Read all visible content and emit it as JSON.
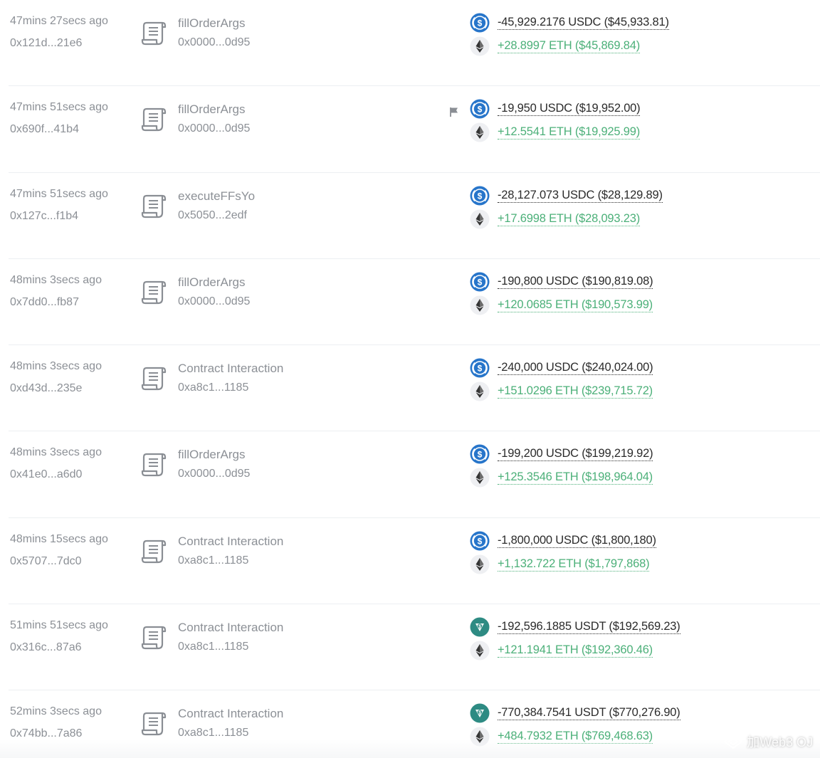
{
  "transactions": [
    {
      "time": "47mins 27secs ago",
      "hash": "0x121d...21e6",
      "method": "fillOrderArgs",
      "contract": "0x0000...0d95",
      "flagged": false,
      "out": {
        "token": "usdc-icon",
        "text": "-45,929.2176 USDC ($45,933.81)"
      },
      "in": {
        "token": "eth-icon",
        "text": "+28.8997 ETH ($45,869.84)"
      }
    },
    {
      "time": "47mins 51secs ago",
      "hash": "0x690f...41b4",
      "method": "fillOrderArgs",
      "contract": "0x0000...0d95",
      "flagged": true,
      "out": {
        "token": "usdc-icon",
        "text": "-19,950 USDC ($19,952.00)"
      },
      "in": {
        "token": "eth-icon",
        "text": "+12.5541 ETH ($19,925.99)"
      }
    },
    {
      "time": "47mins 51secs ago",
      "hash": "0x127c...f1b4",
      "method": "executeFFsYo",
      "contract": "0x5050...2edf",
      "flagged": false,
      "out": {
        "token": "usdc-icon",
        "text": "-28,127.073 USDC ($28,129.89)"
      },
      "in": {
        "token": "eth-icon",
        "text": "+17.6998 ETH ($28,093.23)"
      }
    },
    {
      "time": "48mins 3secs ago",
      "hash": "0x7dd0...fb87",
      "method": "fillOrderArgs",
      "contract": "0x0000...0d95",
      "flagged": false,
      "out": {
        "token": "usdc-icon",
        "text": "-190,800 USDC ($190,819.08)"
      },
      "in": {
        "token": "eth-icon",
        "text": "+120.0685 ETH ($190,573.99)"
      }
    },
    {
      "time": "48mins 3secs ago",
      "hash": "0xd43d...235e",
      "method": "Contract Interaction",
      "contract": "0xa8c1...1185",
      "flagged": false,
      "out": {
        "token": "usdc-icon",
        "text": "-240,000 USDC ($240,024.00)"
      },
      "in": {
        "token": "eth-icon",
        "text": "+151.0296 ETH ($239,715.72)"
      }
    },
    {
      "time": "48mins 3secs ago",
      "hash": "0x41e0...a6d0",
      "method": "fillOrderArgs",
      "contract": "0x0000...0d95",
      "flagged": false,
      "out": {
        "token": "usdc-icon",
        "text": "-199,200 USDC ($199,219.92)"
      },
      "in": {
        "token": "eth-icon",
        "text": "+125.3546 ETH ($198,964.04)"
      }
    },
    {
      "time": "48mins 15secs ago",
      "hash": "0x5707...7dc0",
      "method": "Contract Interaction",
      "contract": "0xa8c1...1185",
      "flagged": false,
      "out": {
        "token": "usdc-icon",
        "text": "-1,800,000 USDC ($1,800,180)"
      },
      "in": {
        "token": "eth-icon",
        "text": "+1,132.722 ETH ($1,797,868)"
      }
    },
    {
      "time": "51mins 51secs ago",
      "hash": "0x316c...87a6",
      "method": "Contract Interaction",
      "contract": "0xa8c1...1185",
      "flagged": false,
      "out": {
        "token": "usdt-icon",
        "text": "-192,596.1885 USDT ($192,569.23)"
      },
      "in": {
        "token": "eth-icon",
        "text": "+121.1941 ETH ($192,360.46)"
      }
    },
    {
      "time": "52mins 3secs ago",
      "hash": "0x74bb...7a86",
      "method": "Contract Interaction",
      "contract": "0xa8c1...1185",
      "flagged": false,
      "out": {
        "token": "usdt-icon",
        "text": "-770,384.7541 USDT ($770,276.90)"
      },
      "in": {
        "token": "eth-icon",
        "text": "+484.7932 ETH ($769,468.63)"
      }
    }
  ],
  "watermark": {
    "text": "加Web3 OJ"
  },
  "colors": {
    "usdc": "#2775ca",
    "usdt": "#2e8b83",
    "eth_bg": "#eeeff2",
    "eth": "#343434",
    "positive": "#4cb079",
    "muted": "#8c9096"
  }
}
